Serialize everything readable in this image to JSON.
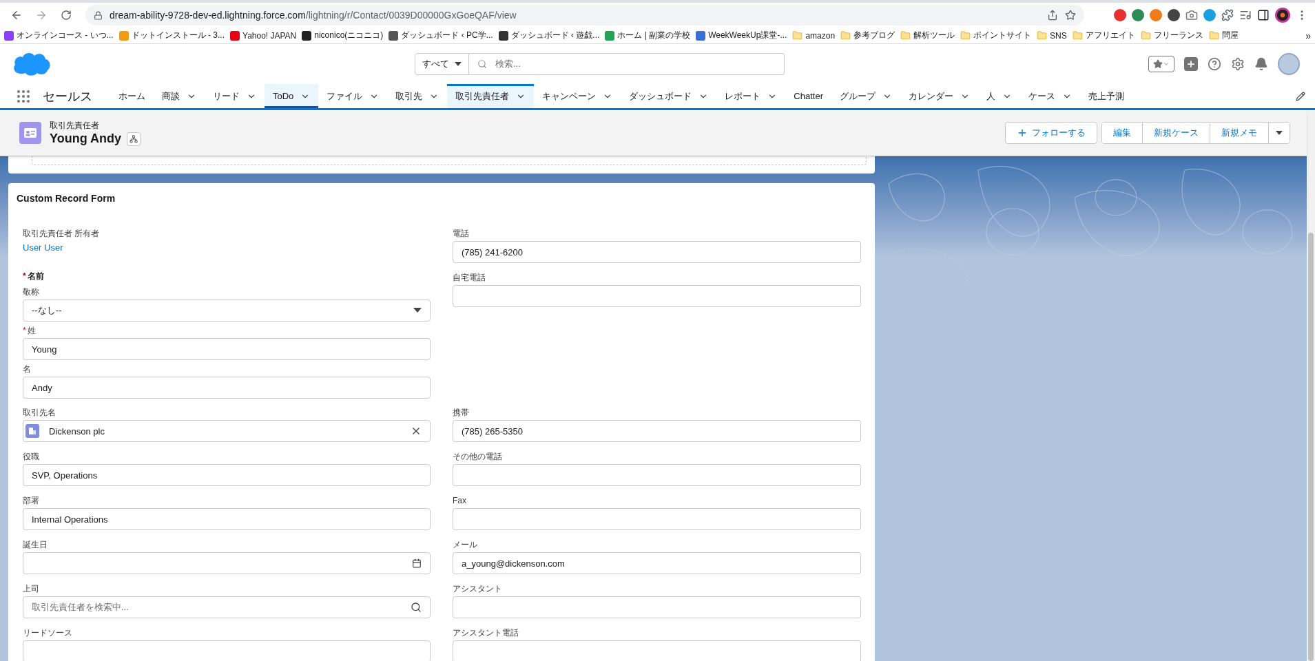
{
  "browser": {
    "url_host": "dream-ability-9728-dev-ed.lightning.force.com",
    "url_path": "/lightning/r/Contact/0039D00000GxGoeQAF/view",
    "bookmarks": [
      {
        "label": "オンラインコース - いつ...",
        "kind": "site"
      },
      {
        "label": "ドットインストール - 3...",
        "kind": "site"
      },
      {
        "label": "Yahoo! JAPAN",
        "kind": "site"
      },
      {
        "label": "niconico(ニコニコ)",
        "kind": "site"
      },
      {
        "label": "ダッシュボード ‹ PC学...",
        "kind": "site"
      },
      {
        "label": "ダッシュボード ‹ 遊戯...",
        "kind": "site"
      },
      {
        "label": "ホーム | 副業の学校",
        "kind": "site"
      },
      {
        "label": "WeekWeekUp課堂-...",
        "kind": "site"
      },
      {
        "label": "amazon",
        "kind": "folder"
      },
      {
        "label": "参考ブログ",
        "kind": "folder"
      },
      {
        "label": "解析ツール",
        "kind": "folder"
      },
      {
        "label": "ポイントサイト",
        "kind": "folder"
      },
      {
        "label": "SNS",
        "kind": "folder"
      },
      {
        "label": "アフリエイト",
        "kind": "folder"
      },
      {
        "label": "フリーランス",
        "kind": "folder"
      },
      {
        "label": "問屋",
        "kind": "folder"
      }
    ],
    "more": "»"
  },
  "global_header": {
    "search_scope": "すべて",
    "search_placeholder": "検索..."
  },
  "nav": {
    "app_name": "セールス",
    "items": [
      {
        "label": "ホーム",
        "dropdown": false,
        "selected": false,
        "highlighted": false
      },
      {
        "label": "商談",
        "dropdown": true,
        "selected": false,
        "highlighted": false
      },
      {
        "label": "リード",
        "dropdown": true,
        "selected": false,
        "highlighted": false
      },
      {
        "label": "ToDo",
        "dropdown": true,
        "selected": false,
        "highlighted": true
      },
      {
        "label": "ファイル",
        "dropdown": true,
        "selected": false,
        "highlighted": false
      },
      {
        "label": "取引先",
        "dropdown": true,
        "selected": false,
        "highlighted": false
      },
      {
        "label": "取引先責任者",
        "dropdown": true,
        "selected": true,
        "highlighted": false
      },
      {
        "label": "キャンペーン",
        "dropdown": true,
        "selected": false,
        "highlighted": false
      },
      {
        "label": "ダッシュボード",
        "dropdown": true,
        "selected": false,
        "highlighted": false
      },
      {
        "label": "レポート",
        "dropdown": true,
        "selected": false,
        "highlighted": false
      },
      {
        "label": "Chatter",
        "dropdown": false,
        "selected": false,
        "highlighted": false
      },
      {
        "label": "グループ",
        "dropdown": true,
        "selected": false,
        "highlighted": false
      },
      {
        "label": "カレンダー",
        "dropdown": true,
        "selected": false,
        "highlighted": false
      },
      {
        "label": "人",
        "dropdown": true,
        "selected": false,
        "highlighted": false
      },
      {
        "label": "ケース",
        "dropdown": true,
        "selected": false,
        "highlighted": false
      },
      {
        "label": "売上予測",
        "dropdown": false,
        "selected": false,
        "highlighted": false
      }
    ]
  },
  "record_header": {
    "object_label": "取引先責任者",
    "name": "Young Andy",
    "follow_button": "フォローする",
    "actions": [
      "編集",
      "新規ケース",
      "新規メモ"
    ]
  },
  "form": {
    "title": "Custom Record Form",
    "top_left": [
      {
        "kind": "link",
        "label": "取引先責任者 所有者",
        "value": "User User"
      },
      {
        "kind": "heading",
        "label": "名前",
        "required_mark": "*"
      },
      {
        "kind": "select",
        "label": "敬称",
        "value": "--なし--"
      },
      {
        "kind": "text",
        "label": "姓",
        "value": "Young",
        "required_mark": "*"
      },
      {
        "kind": "text",
        "label": "名",
        "value": "Andy"
      }
    ],
    "top_right": [
      {
        "kind": "text",
        "label": "電話",
        "value": "(785) 241-6200"
      },
      {
        "kind": "text",
        "label": "自宅電話"
      }
    ],
    "rows": [
      [
        {
          "kind": "lookup",
          "label": "取引先名",
          "value": "Dickenson plc"
        },
        {
          "kind": "text",
          "label": "携帯",
          "value": "(785) 265-5350"
        }
      ],
      [
        {
          "kind": "text",
          "label": "役職",
          "value": "SVP, Operations"
        },
        {
          "kind": "text",
          "label": "その他の電話"
        }
      ],
      [
        {
          "kind": "text",
          "label": "部署",
          "value": "Internal Operations"
        },
        {
          "kind": "text",
          "label": "Fax"
        }
      ],
      [
        {
          "kind": "date",
          "label": "誕生日"
        },
        {
          "kind": "text",
          "label": "メール",
          "value": "a_young@dickenson.com"
        }
      ],
      [
        {
          "kind": "search",
          "label": "上司",
          "placeholder": "取引先責任者を検索中..."
        },
        {
          "kind": "text",
          "label": "アシスタント"
        }
      ],
      [
        {
          "kind": "text",
          "label": "リードソース"
        },
        {
          "kind": "text",
          "label": "アシスタント電話"
        }
      ]
    ]
  }
}
